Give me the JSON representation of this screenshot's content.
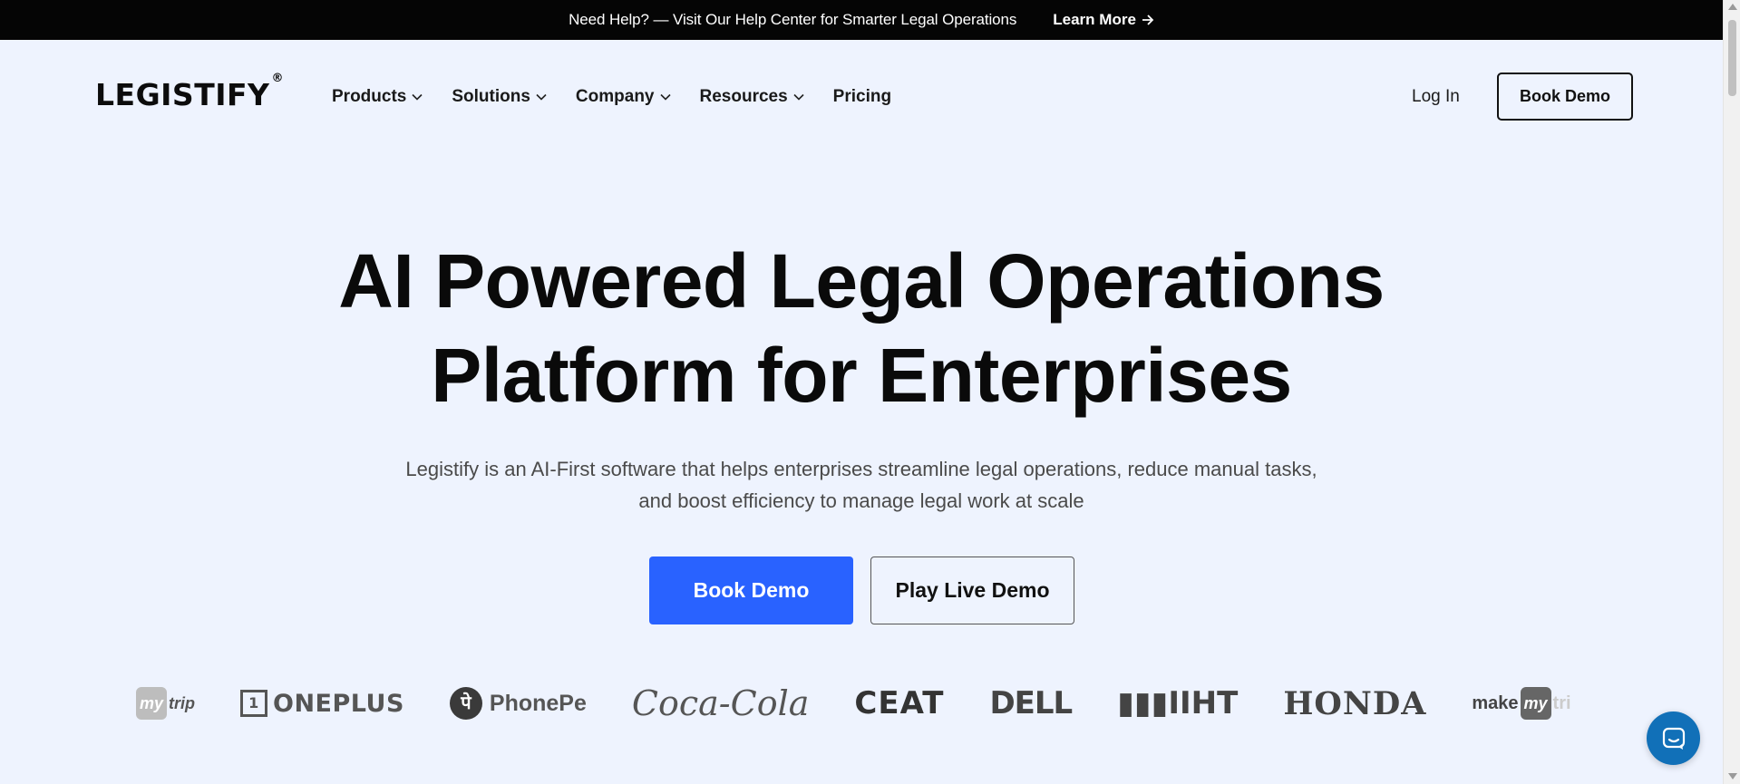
{
  "topbar": {
    "message": "Need Help? — Visit Our Help Center for Smarter Legal Operations",
    "link_label": "Learn More",
    "link_icon": "arrow-right-icon"
  },
  "header": {
    "logo_text": "LEGISTIFY",
    "logo_mark": "®",
    "nav": [
      {
        "label": "Products",
        "has_dropdown": true
      },
      {
        "label": "Solutions",
        "has_dropdown": true
      },
      {
        "label": "Company",
        "has_dropdown": true
      },
      {
        "label": "Resources",
        "has_dropdown": true
      },
      {
        "label": "Pricing",
        "has_dropdown": false
      }
    ],
    "login_label": "Log In",
    "book_demo_label": "Book Demo"
  },
  "hero": {
    "title_line1": "AI Powered Legal Operations",
    "title_line2": "Platform for Enterprises",
    "subtitle_line1": "Legistify is an AI-First software that helps enterprises streamline legal operations, reduce manual tasks,",
    "subtitle_line2": "and boost efficiency to manage legal work at scale",
    "primary_cta": "Book Demo",
    "secondary_cta": "Play Live Demo"
  },
  "client_logos": [
    "mytrip",
    "ONEPLUS",
    "PhonePe",
    "Coca-Cola",
    "CEAT",
    "DELL",
    "IIHT",
    "HONDA",
    "makemytrip"
  ],
  "colors": {
    "accent": "#2962ff",
    "page_bg": "#eef3fe",
    "topbar_bg": "#050505",
    "chat_bg": "#1170b8"
  },
  "chat_widget": {
    "icon": "chat-bubble-icon"
  }
}
